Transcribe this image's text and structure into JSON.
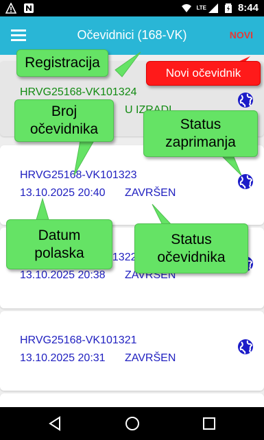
{
  "status_bar": {
    "time": "8:44",
    "network": "LTE"
  },
  "app_bar": {
    "title": "Očevidnici (168-VK)",
    "new_label": "NOVI"
  },
  "records": [
    {
      "id": "HRVG25168-VK101324",
      "date": "",
      "status": "U IZRADI",
      "selected": true
    },
    {
      "id": "HRVG25168-VK101323",
      "date": "13.10.2025 20:40",
      "status": "ZAVRŠEN"
    },
    {
      "id": "HRVG25168-VK101322",
      "date": "13.10.2025 20:38",
      "status": "ZAVRŠEN"
    },
    {
      "id": "HRVG25168-VK101321",
      "date": "13.10.2025 20:31",
      "status": "ZAVRŠEN"
    }
  ],
  "callouts": {
    "registracija": "Registracija",
    "novi_ocevidnik": "Novi očevidnik",
    "broj_line1": "Broj",
    "broj_line2": "očevidnika",
    "status_zap_line1": "Status",
    "status_zap_line2": "zaprimanja",
    "datum_line1": "Datum",
    "datum_line2": "polaska",
    "status_oce_line1": "Status",
    "status_oce_line2": "očevidnika"
  },
  "icons": {
    "menu": "hamburger-menu-icon",
    "globe": "globe-icon",
    "back": "back-triangle-icon",
    "home": "home-circle-icon",
    "recents": "recents-square-icon"
  },
  "colors": {
    "app_bar": "#29b6d6",
    "new_button": "#e53935",
    "callout_green": "#65e365",
    "callout_red": "#ff1a1a",
    "record_text": "#2020c0",
    "selected_text": "#118a11"
  }
}
